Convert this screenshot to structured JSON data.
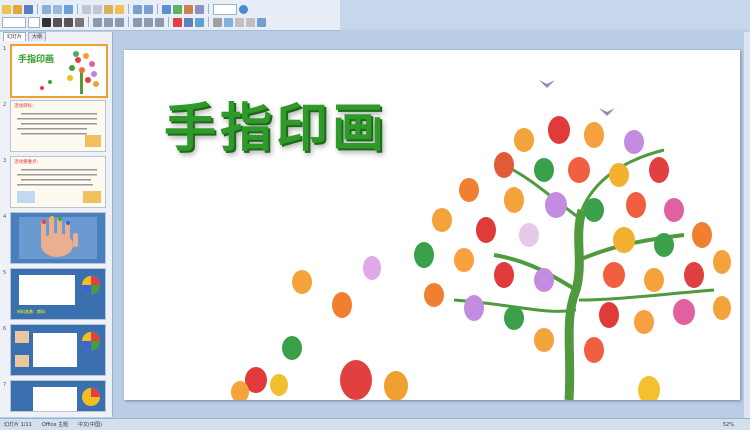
{
  "slide": {
    "title": "手指印画"
  },
  "panel": {
    "tabs": [
      "幻灯片",
      "大纲"
    ]
  },
  "thumbnails": [
    {
      "title": "手指印画"
    },
    {
      "heading": "活动目标："
    },
    {
      "heading": "活动重难点："
    },
    {},
    {
      "caption": "材料准备：颜料"
    },
    {},
    {}
  ],
  "statusbar": {
    "slide_info": "幻灯片 1/11",
    "theme": "Office 主题",
    "lang": "中文(中国)",
    "zoom": "52%"
  },
  "colors": {
    "title_green": "#2f9a2a",
    "selection": "#f0a030"
  }
}
